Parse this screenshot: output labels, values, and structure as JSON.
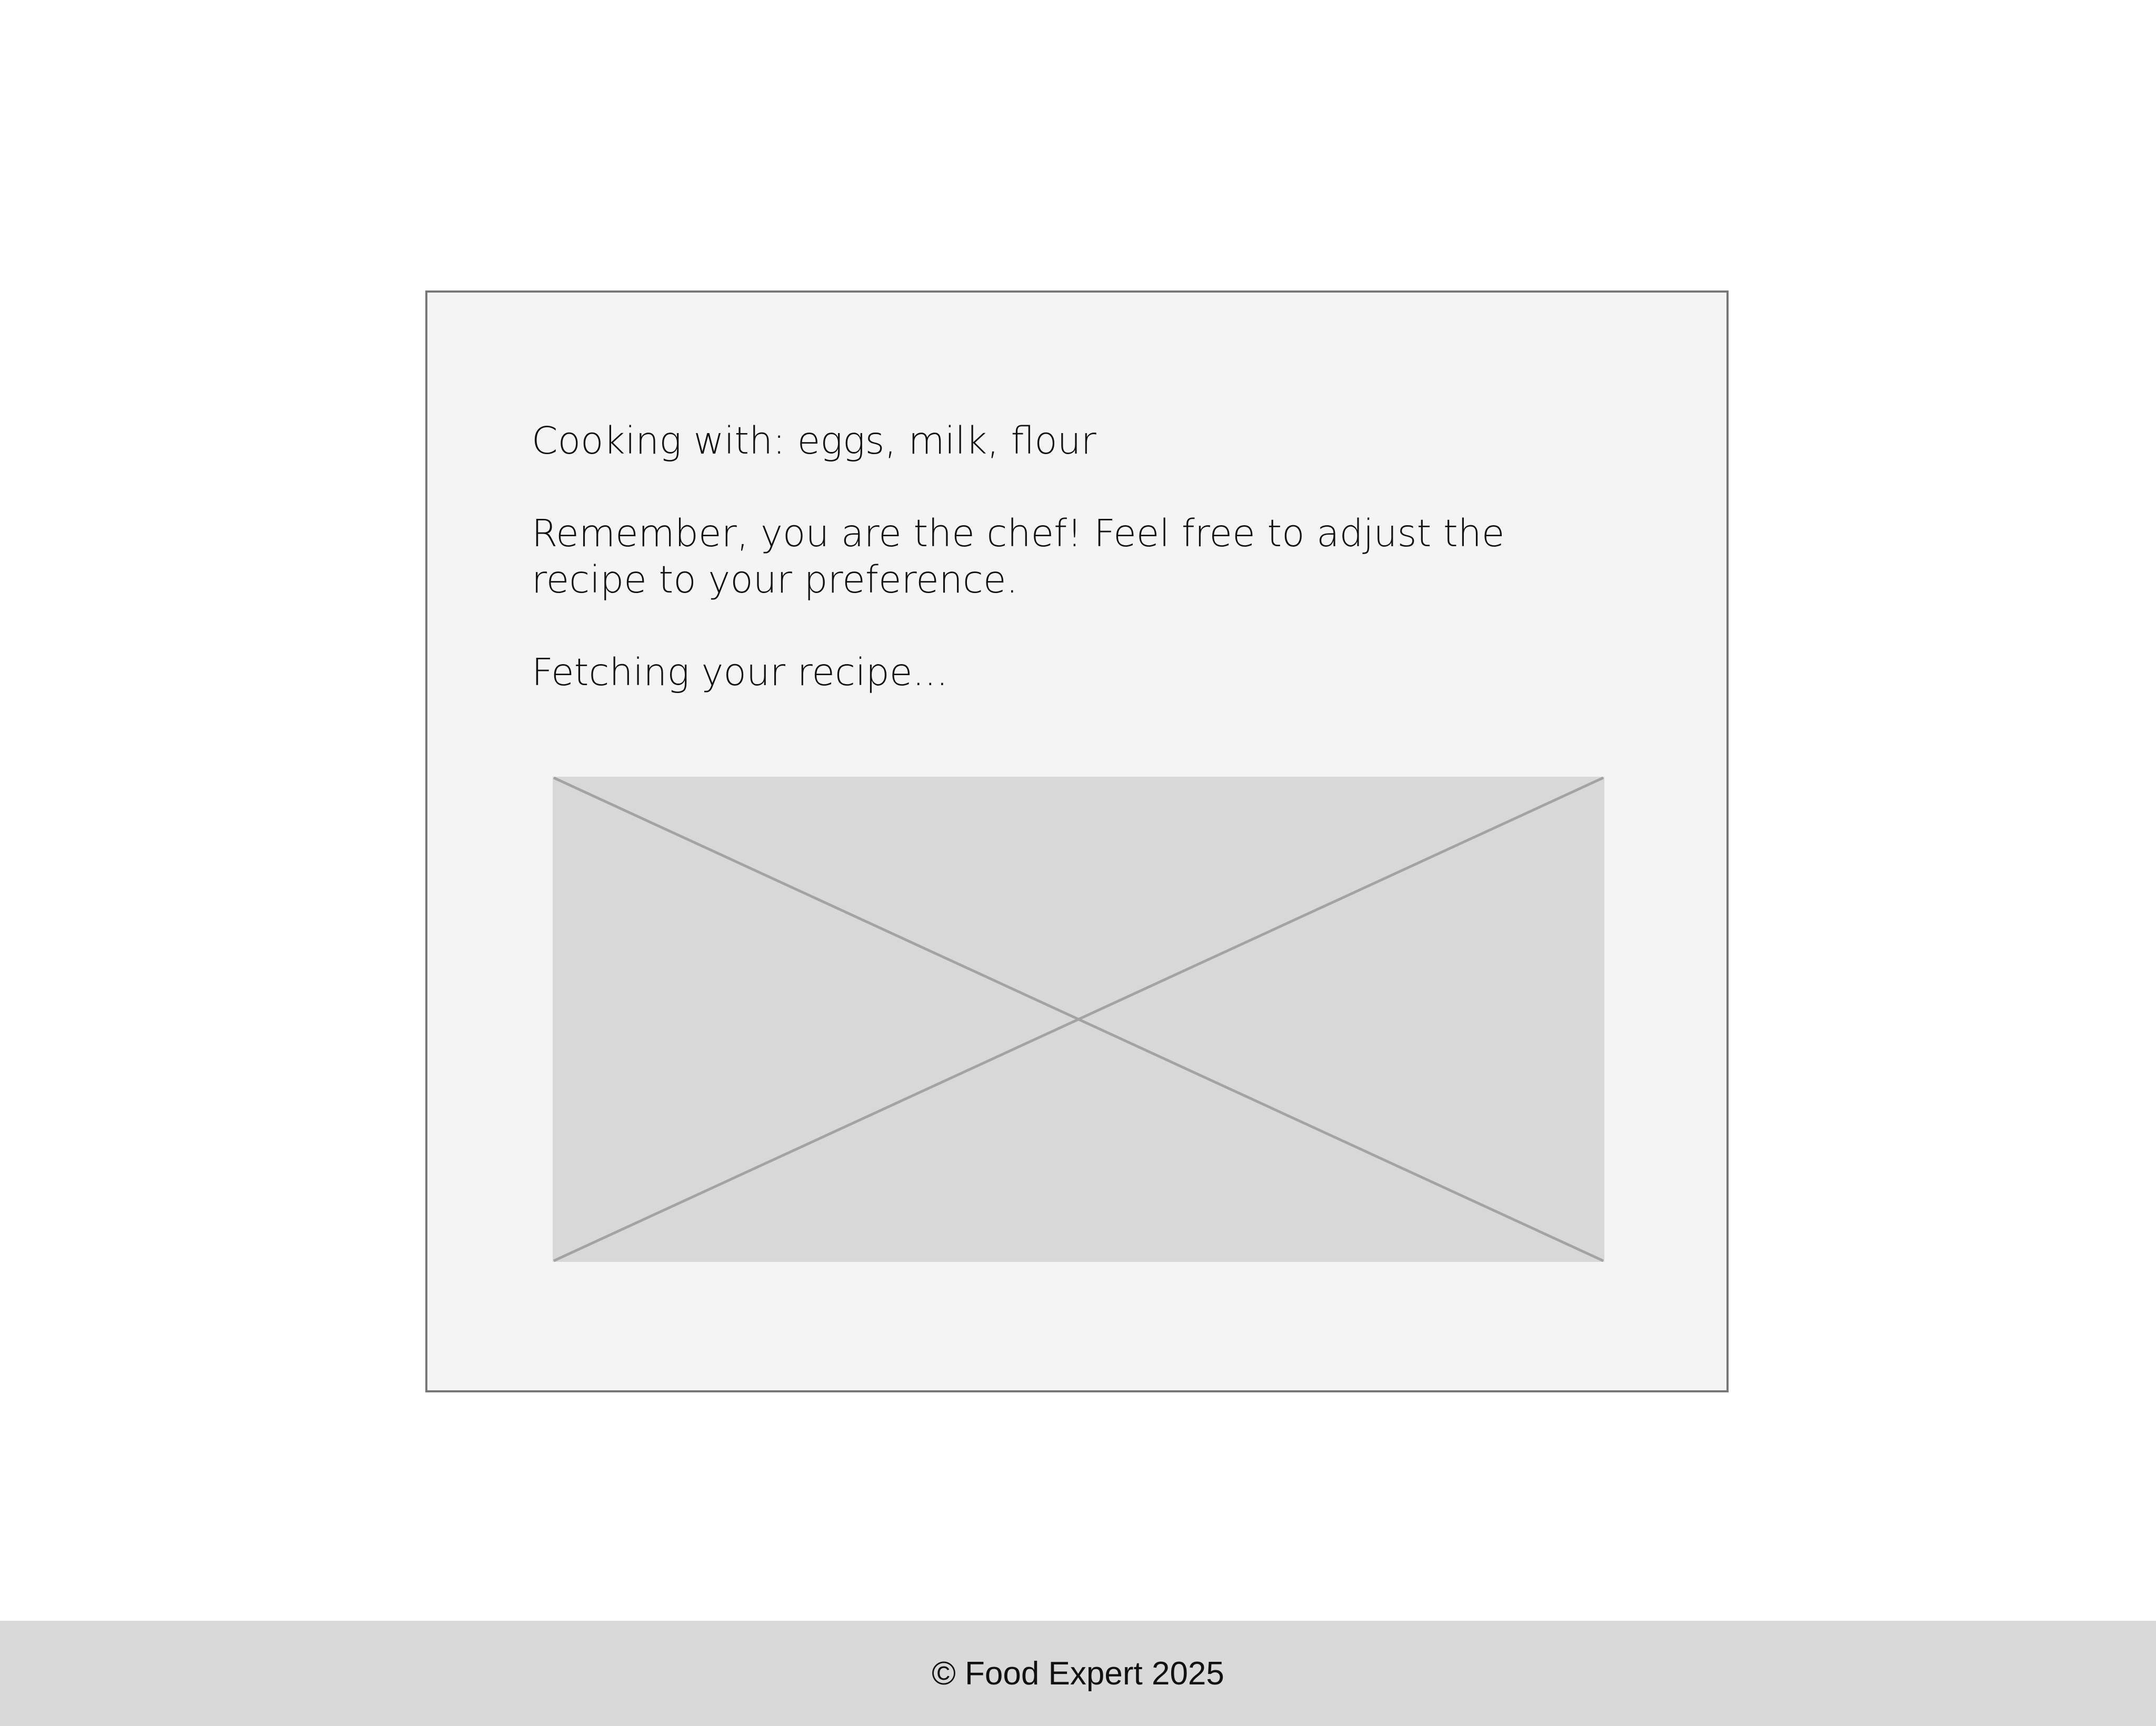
{
  "content": {
    "ingredients_line": "Cooking with: eggs, milk, flour",
    "chef_message": "Remember, you are the chef! Feel free to adjust the recipe to your preference.",
    "status": "Fetching your recipe..."
  },
  "image_placeholder": {
    "icon": "image-placeholder-x-icon"
  },
  "footer": {
    "copyright": "© Food Expert 2025"
  }
}
